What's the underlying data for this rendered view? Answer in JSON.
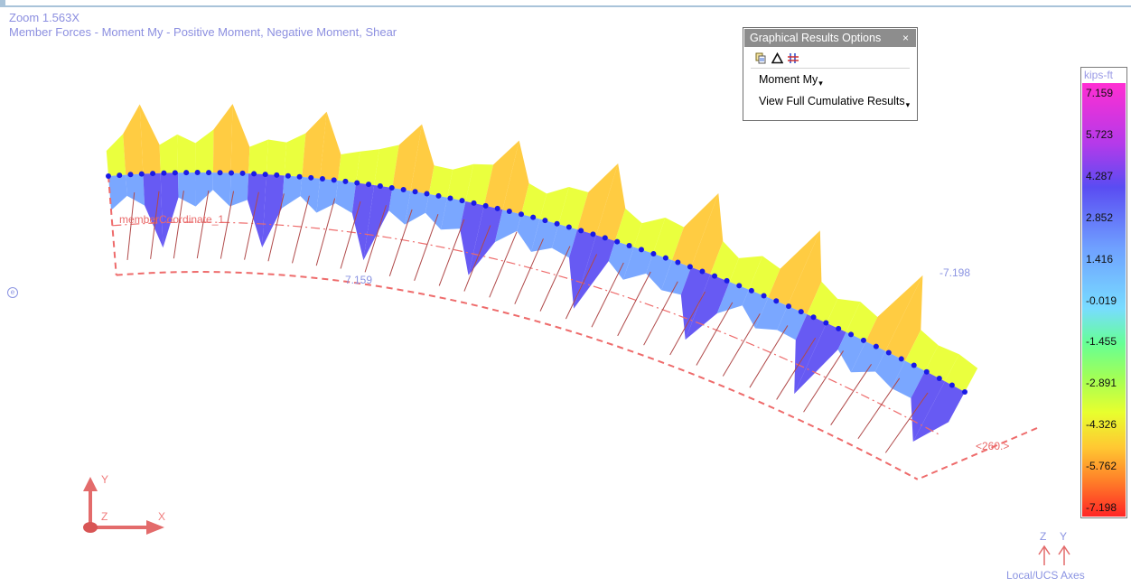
{
  "hud": {
    "zoom": "Zoom  1.563X",
    "result_type": "Member Forces - Moment My - Positive Moment, Negative Moment, Shear"
  },
  "palette": {
    "title": "Graphical Results Options",
    "close_glyph": "×",
    "tool_icons": [
      "copy-results-icon",
      "delta-icon",
      "split-members-icon"
    ],
    "items": [
      {
        "label": "Moment My",
        "caret": "▾"
      },
      {
        "label": "View Full Cumulative Results",
        "caret": "▾"
      }
    ]
  },
  "legend": {
    "unit": "kips-ft",
    "values": [
      "7.159",
      "5.723",
      "4.287",
      "2.852",
      "1.416",
      "-0.019",
      "-1.455",
      "-2.891",
      "-4.326",
      "-5.762",
      "-7.198"
    ],
    "colors": [
      "#ff2ed2",
      "#b43aea",
      "#5a4cf2",
      "#6fa0ff",
      "#78dcff",
      "#66ff95",
      "#a2ff56",
      "#e8ff2e",
      "#ffc832",
      "#ff7d28",
      "#ff2626"
    ]
  },
  "viewport": {
    "member_label": "memberCoordinate_1",
    "max_label": "7.159",
    "min_label": "-7.198",
    "node_label": "<260.>",
    "global_axes": {
      "x": "X",
      "y": "Y",
      "z": "Z"
    },
    "ucs_axes": {
      "z": "Z",
      "y": "Y",
      "label": "Local/UCS Axes"
    },
    "home_glyph": "e",
    "member_color": "#1a1ae6",
    "guide_color": "#ee6b6b"
  }
}
